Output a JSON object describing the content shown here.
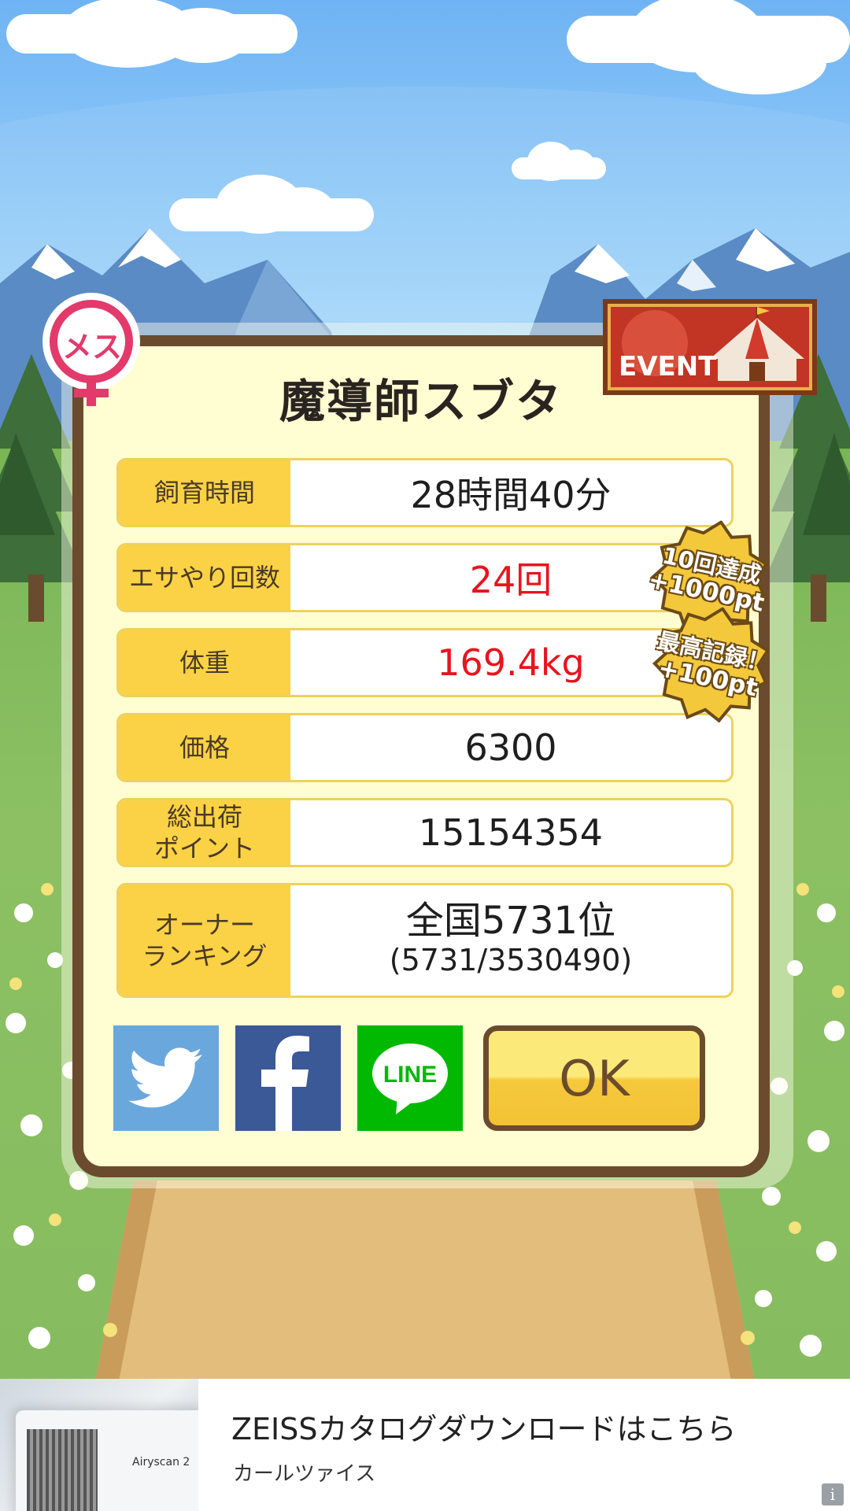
{
  "game": {
    "pig_name": "魔導師スブタ",
    "gender_label": "メス",
    "event_label": "EVENT",
    "stats": [
      {
        "label": "飼育時間",
        "value": "28時間40分",
        "highlight": false
      },
      {
        "label": "エサやり回数",
        "value": "24回",
        "highlight": true
      },
      {
        "label": "体重",
        "value": "169.4kg",
        "highlight": true
      },
      {
        "label": "価格",
        "value": "6300",
        "highlight": false
      },
      {
        "label": "総出荷\nポイント",
        "value": "15154354",
        "highlight": false
      }
    ],
    "ranking": {
      "label": "オーナー\nランキング",
      "value": "全国5731位",
      "detail": "(5731/3530490)"
    },
    "badges": [
      {
        "line1": "10回達成",
        "line2": "+1000pt"
      },
      {
        "line1": "最高記録！",
        "line2": "+100pt"
      }
    ],
    "share": {
      "twitter_icon": "twitter-bird-icon",
      "facebook_icon": "facebook-f-icon",
      "line_label": "LINE"
    },
    "ok_label": "OK"
  },
  "ad": {
    "title": "ZEISSカタログダウンロードはこちら",
    "subtitle": "カールツァイス",
    "image_text": "Airyscan 2",
    "info_icon": "i"
  },
  "colors": {
    "label_bg": "#fbd245",
    "panel_bg": "#fffdd2",
    "panel_border": "#6b4b2e",
    "highlight_text": "#e8141e",
    "twitter": "#6aa7dd",
    "facebook": "#3b5897",
    "line": "#00b900"
  }
}
